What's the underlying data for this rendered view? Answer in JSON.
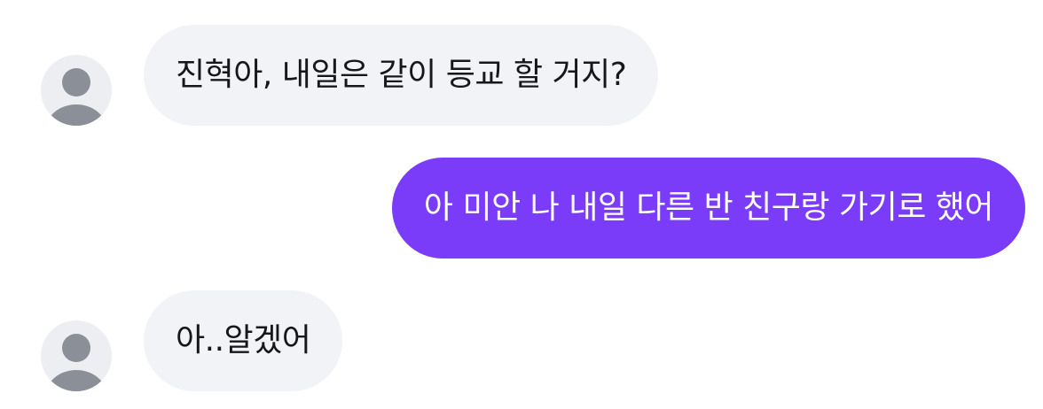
{
  "chat": {
    "messages": [
      {
        "direction": "incoming",
        "text": "진혁아, 내일은 같이 등교 할 거지?"
      },
      {
        "direction": "outgoing",
        "text": "아 미안 나 내일 다른 반 친구랑 가기로 했어"
      },
      {
        "direction": "incoming",
        "text": "아..알겠어"
      }
    ]
  },
  "colors": {
    "incoming_bubble": "#f2f3f6",
    "outgoing_bubble": "#7a3cf8",
    "avatar_bg": "#eceef2",
    "avatar_icon": "#8b8f98"
  }
}
